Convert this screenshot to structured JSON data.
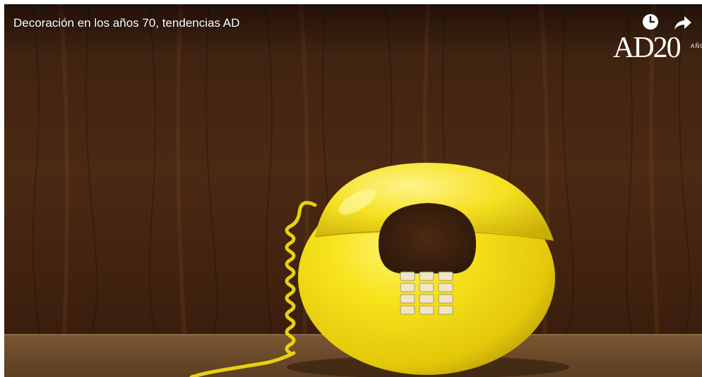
{
  "video": {
    "title": "Decoración en los años 70, tendencias AD",
    "scene_description": "yellow-round-telephone-on-wooden-table"
  },
  "controls": {
    "watch_later_icon": "clock-icon",
    "share_icon": "share-arrow-icon"
  },
  "channel_logo": {
    "text": "AD20",
    "subtext": "AÑOS"
  },
  "colors": {
    "phone_yellow": "#f2dd10",
    "wood_dark": "#3a1f0d",
    "wood_light": "#5a3318",
    "table": "#6b4a2c"
  }
}
